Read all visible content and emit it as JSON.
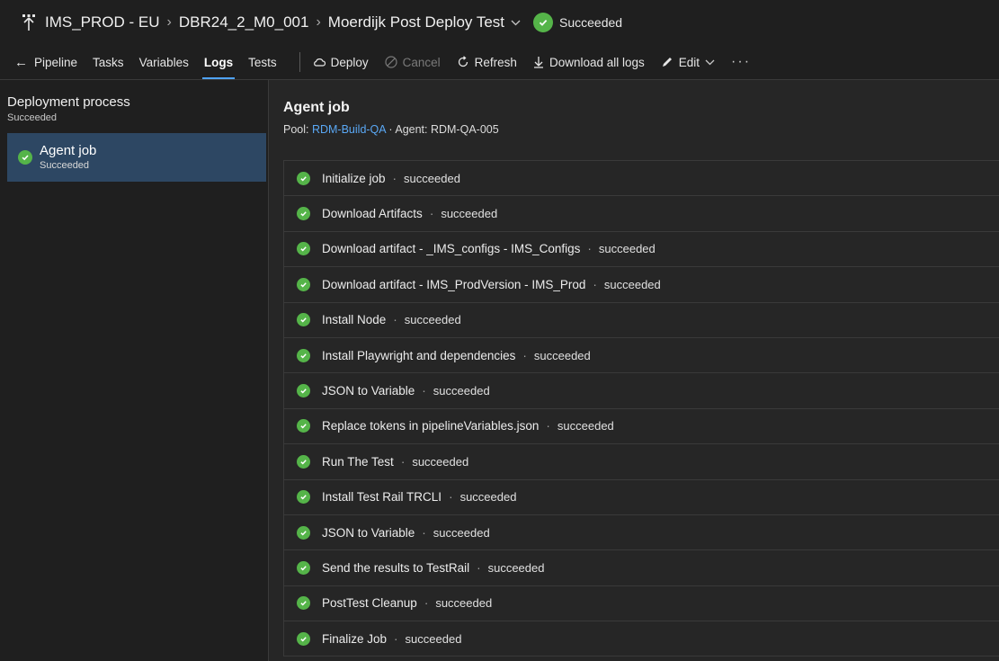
{
  "breadcrumb": {
    "project": "IMS_PROD - EU",
    "release": "DBR24_2_M0_001",
    "stage": "Moerdijk Post Deploy Test",
    "status": "Succeeded"
  },
  "toolbar": {
    "back_label": "Pipeline",
    "tabs": [
      "Tasks",
      "Variables",
      "Logs",
      "Tests"
    ],
    "active_tab": "Logs",
    "deploy": "Deploy",
    "cancel": "Cancel",
    "refresh": "Refresh",
    "download": "Download all logs",
    "edit": "Edit",
    "more": "···"
  },
  "sidebar": {
    "section_title": "Deployment process",
    "section_status": "Succeeded",
    "item_label": "Agent job",
    "item_status": "Succeeded"
  },
  "main": {
    "title": "Agent job",
    "pool_label": "Pool: ",
    "pool_value": "RDM-Build-QA",
    "agent_text": " · Agent: RDM-QA-005",
    "steps": [
      {
        "name": "Initialize job",
        "status": "succeeded"
      },
      {
        "name": "Download Artifacts",
        "status": "succeeded"
      },
      {
        "name": "Download artifact - _IMS_configs - IMS_Configs",
        "status": "succeeded"
      },
      {
        "name": "Download artifact - IMS_ProdVersion - IMS_Prod",
        "status": "succeeded"
      },
      {
        "name": "Install Node",
        "status": "succeeded"
      },
      {
        "name": "Install Playwright and dependencies",
        "status": "succeeded"
      },
      {
        "name": "JSON to Variable",
        "status": "succeeded"
      },
      {
        "name": "Replace tokens in pipelineVariables.json",
        "status": "succeeded"
      },
      {
        "name": "Run The Test",
        "status": "succeeded"
      },
      {
        "name": "Install Test Rail TRCLI",
        "status": "succeeded"
      },
      {
        "name": "JSON to Variable",
        "status": "succeeded"
      },
      {
        "name": "Send the results to TestRail",
        "status": "succeeded"
      },
      {
        "name": "PostTest Cleanup",
        "status": "succeeded"
      },
      {
        "name": "Finalize Job",
        "status": "succeeded"
      }
    ]
  },
  "colors": {
    "success": "#55b449",
    "accent": "#4fa3f7",
    "selected": "#2d4763"
  }
}
